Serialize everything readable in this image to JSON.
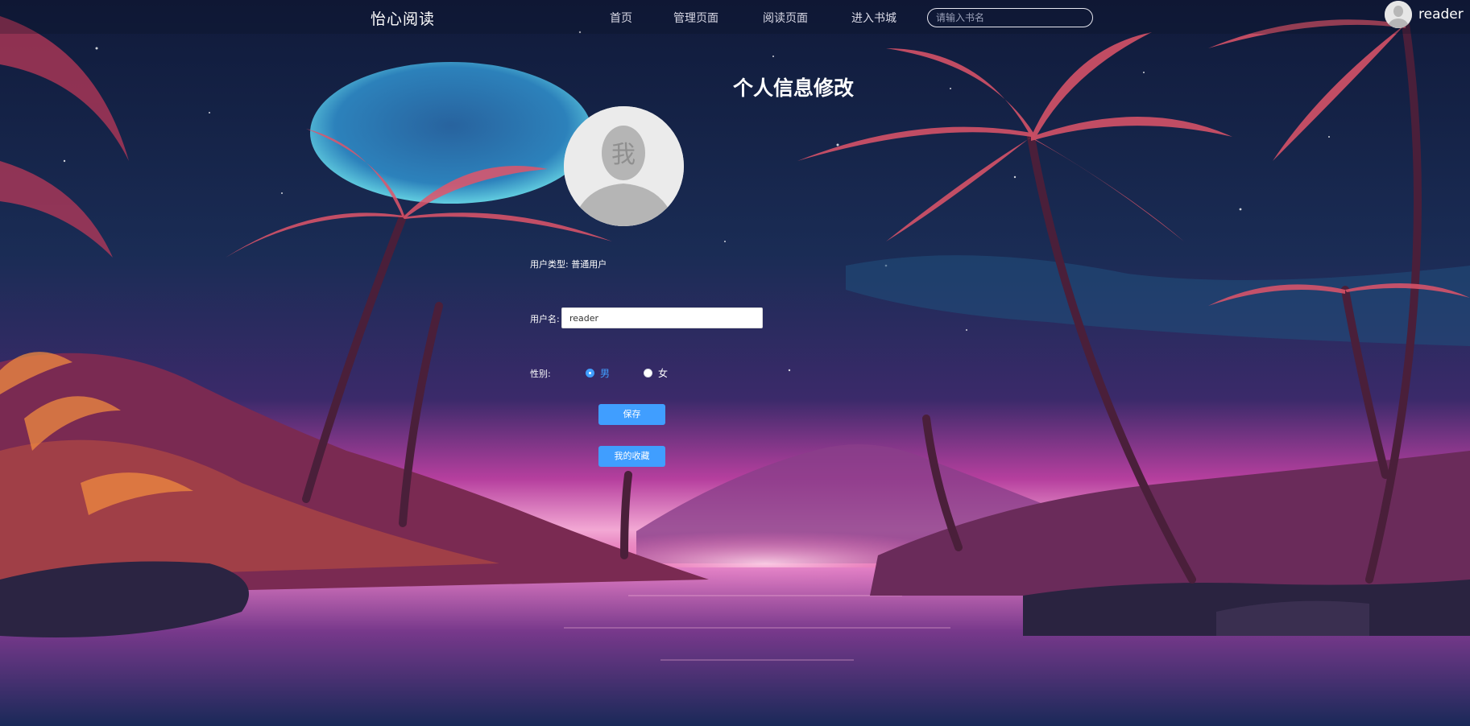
{
  "header": {
    "brand": "怡心阅读",
    "nav": [
      {
        "label": "首页"
      },
      {
        "label": "管理页面"
      },
      {
        "label": "阅读页面"
      },
      {
        "label": "进入书城"
      }
    ],
    "search_placeholder": "请输入书名",
    "user_name": "reader"
  },
  "main": {
    "title": "个人信息修改",
    "avatar_text": "我",
    "user_type": "用户类型: 普通用户",
    "username_label": "用户名:",
    "username_value": "reader",
    "gender_label": "性别:",
    "gender_options": [
      {
        "label": "男",
        "selected": true
      },
      {
        "label": "女",
        "selected": false
      }
    ],
    "save_label": "保存",
    "favorites_label": "我的收藏"
  },
  "colors": {
    "accent": "#409eff",
    "text_on_dark": "#ffffff"
  },
  "icons": {
    "header_avatar": "user-avatar-icon",
    "profile_avatar": "user-avatar-icon"
  }
}
